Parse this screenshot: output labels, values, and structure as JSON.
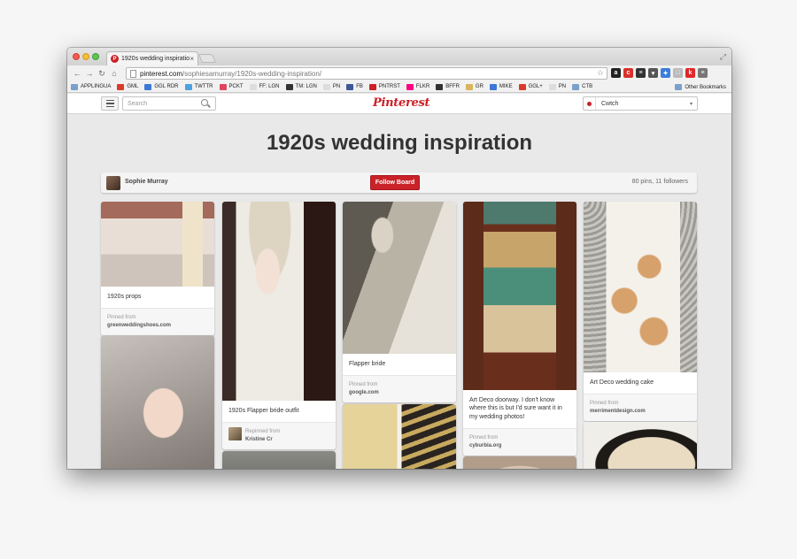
{
  "browser": {
    "tab_title": "1920s wedding inspiratio",
    "tab_close": "×",
    "url_host": "pinterest.com",
    "url_path": "/sophiesamurray/1920s-wedding-inspiration/",
    "star_icon": "☆",
    "expand_icon": "⤢",
    "nav": {
      "back": "←",
      "forward": "→",
      "reload": "↻",
      "home": "⌂"
    },
    "extensions": [
      {
        "icon": "amazon-icon",
        "glyph": "a",
        "color": "#222222"
      },
      {
        "icon": "readability-icon",
        "glyph": "c",
        "color": "#d9322b"
      },
      {
        "icon": "buffer-icon",
        "glyph": "≡",
        "color": "#333333"
      },
      {
        "icon": "pocket-icon",
        "glyph": "▾",
        "color": "#555555"
      },
      {
        "icon": "lastpass-icon",
        "glyph": "✦",
        "color": "#3b7dd8"
      },
      {
        "icon": "doc-icon",
        "glyph": "□",
        "color": "#bbbbbb"
      },
      {
        "icon": "klout-icon",
        "glyph": "k",
        "color": "#e0282a"
      },
      {
        "icon": "chrome-menu-icon",
        "glyph": "≡",
        "color": "#777777"
      }
    ],
    "bookmarks": [
      {
        "label": "APPLINGUA",
        "icon": "folder-icon",
        "color": "#7aa0cc"
      },
      {
        "label": "GML",
        "icon": "gmail-icon",
        "color": "#d93b2b"
      },
      {
        "label": "GGL RDR",
        "icon": "reader-icon",
        "color": "#3c78d8"
      },
      {
        "label": "TWTTR",
        "icon": "twitter-icon",
        "color": "#4aa3df"
      },
      {
        "label": "PCKT",
        "icon": "pocket-icon",
        "color": "#e0455d"
      },
      {
        "label": "FF: LGN",
        "icon": "page-icon",
        "color": "#dddddd"
      },
      {
        "label": "TM: LGN",
        "icon": "globe-icon",
        "color": "#333333"
      },
      {
        "label": "PN",
        "icon": "page-icon",
        "color": "#dddddd"
      },
      {
        "label": "FB",
        "icon": "facebook-icon",
        "color": "#3b5998"
      },
      {
        "label": "PNTRST",
        "icon": "pinterest-icon",
        "color": "#cb2027"
      },
      {
        "label": "FLKR",
        "icon": "flickr-icon",
        "color": "#ff0084"
      },
      {
        "label": "BFFR",
        "icon": "buffer-icon",
        "color": "#333333"
      },
      {
        "label": "GR",
        "icon": "goodreads-icon",
        "color": "#d7b55a"
      },
      {
        "label": "MIKE",
        "icon": "google-icon",
        "color": "#3c78d8"
      },
      {
        "label": "GGL+",
        "icon": "gplus-icon",
        "color": "#d93b2b"
      },
      {
        "label": "PN",
        "icon": "page-icon",
        "color": "#dddddd"
      },
      {
        "label": "CTB",
        "icon": "folder-icon",
        "color": "#7aa0cc"
      }
    ],
    "other_bookmarks": "Other Bookmarks"
  },
  "header": {
    "search_placeholder": "Search",
    "logo": "Pinterest",
    "user_name": "Cwtch",
    "caret": "▾"
  },
  "board": {
    "title": "1920s wedding inspiration",
    "owner": "Sophie Murray",
    "follow_label": "Follow Board",
    "stats": "80 pins, 11 followers"
  },
  "pins": [
    {
      "desc": "1920s props",
      "attr_label": "Pinned from",
      "attr_src": "greenweddingshoes.com"
    },
    {
      "desc": "1920s Flapper bride outfit",
      "attr_label": "Repinned from",
      "attr_src": "Kristine Cr"
    },
    {
      "desc": "Flapper bride",
      "attr_label": "Pinned from",
      "attr_src": "google.com"
    },
    {
      "desc": "Art Deco doorway. I don't know where this is but I'd sure want it in my wedding photos!",
      "attr_label": "Pinned from",
      "attr_src": "cyburbia.org"
    },
    {
      "desc": "Art Deco wedding cake",
      "attr_label": "Pinned from",
      "attr_src": "merrimentdesign.com"
    }
  ],
  "colors": {
    "pinterest_red": "#cb2027",
    "follow_button": "#c92228"
  }
}
